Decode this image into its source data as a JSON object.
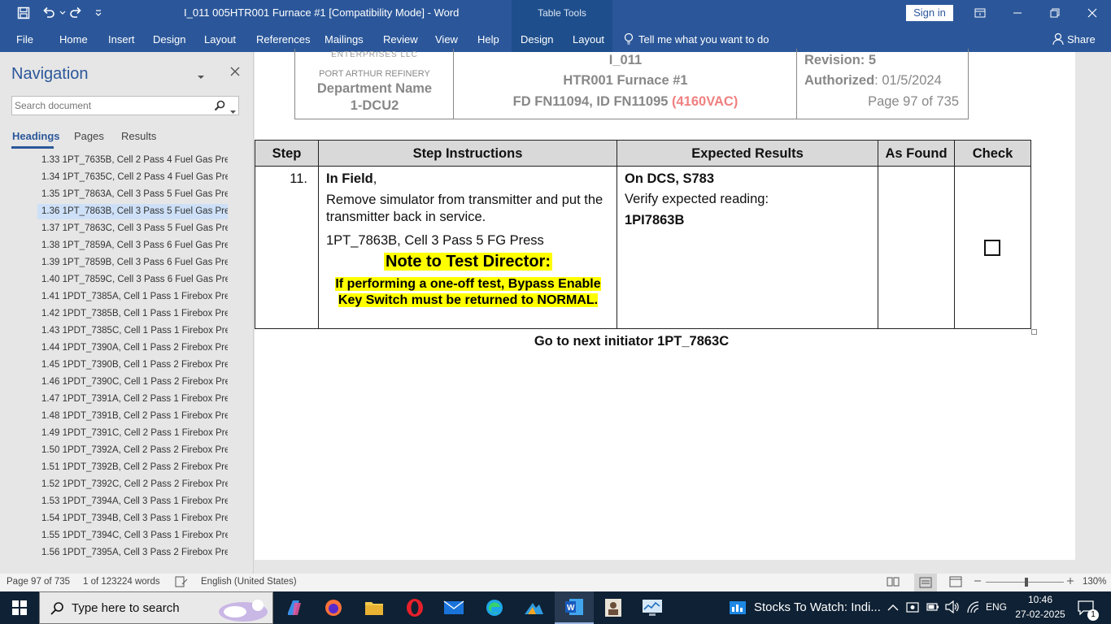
{
  "window": {
    "title": "I_011 005HTR001 Furnace #1 [Compatibility Mode] - Word",
    "table_tools_label": "Table Tools",
    "sign_in": "Sign in"
  },
  "ribbon": {
    "tabs": [
      "File",
      "Home",
      "Insert",
      "Design",
      "Layout",
      "References",
      "Mailings",
      "Review",
      "View",
      "Help",
      "Design",
      "Layout"
    ],
    "tell_me": "Tell me what you want to do",
    "share": "Share"
  },
  "navigation": {
    "title": "Navigation",
    "search_placeholder": "Search document",
    "tabs": [
      "Headings",
      "Pages",
      "Results"
    ],
    "selected_index": 3,
    "headings": [
      "1.33 1PT_7635B, Cell 2 Pass 4 Fuel Gas Pre...",
      "1.34 1PT_7635C, Cell 2 Pass 4 Fuel Gas Pre...",
      "1.35 1PT_7863A, Cell 3 Pass 5 Fuel Gas Pre...",
      "1.36 1PT_7863B, Cell 3 Pass 5 Fuel Gas Pre...",
      "1.37 1PT_7863C, Cell 3 Pass 5 Fuel Gas Pre...",
      "1.38 1PT_7859A, Cell 3 Pass 6 Fuel Gas Pre...",
      "1.39 1PT_7859B, Cell 3 Pass 6 Fuel Gas Pre...",
      "1.40 1PT_7859C, Cell 3 Pass 6 Fuel Gas Pre...",
      "1.41 1PDT_7385A, Cell 1 Pass 1 Firebox Pre...",
      "1.42 1PDT_7385B, Cell 1 Pass 1 Firebox Pre...",
      "1.43 1PDT_7385C, Cell 1 Pass 1 Firebox Pre...",
      "1.44 1PDT_7390A, Cell 1 Pass 2 Firebox Pre...",
      "1.45 1PDT_7390B, Cell 1 Pass 2 Firebox Pre...",
      "1.46 1PDT_7390C, Cell 1 Pass 2 Firebox Pre...",
      "1.47 1PDT_7391A, Cell 2 Pass 1 Firebox Pre...",
      "1.48 1PDT_7391B, Cell 2 Pass 1 Firebox Pre...",
      "1.49 1PDT_7391C, Cell 2 Pass 1 Firebox Pre...",
      "1.50 1PDT_7392A, Cell 2 Pass 2 Firebox Pre...",
      "1.51 1PDT_7392B, Cell 2 Pass 2 Firebox Pre...",
      "1.52 1PDT_7392C, Cell 2 Pass 2 Firebox Pre...",
      "1.53 1PDT_7394A, Cell 3 Pass 1 Firebox Pre...",
      "1.54 1PDT_7394B, Cell 3 Pass 1 Firebox Pre...",
      "1.55 1PDT_7394C, Cell 3 Pass 1 Firebox Pre...",
      "1.56 1PDT_7395A, Cell 3 Pass 2 Firebox Pre..."
    ]
  },
  "doc_header": {
    "company_partial": "ENTERPRISES LLC",
    "refinery": "PORT ARTHUR REFINERY",
    "dept_line1": "Department Name",
    "dept_line2": "1-DCU2",
    "doc_id": "I_011",
    "equipment": "HTR001 Furnace #1",
    "fd_line": "FD FN11094, ID FN11095 ",
    "voltage": "(4160VAC)",
    "revision": "Revision: 5",
    "authorized_label": "Authorized",
    "authorized_date": ": 01/5/2024",
    "page_label": "Page 97 of 735"
  },
  "step_table": {
    "headers": [
      "Step",
      "Step Instructions",
      "Expected Results",
      "As Found",
      "Check"
    ],
    "step_number": "11.",
    "instr_field": "In Field",
    "instr_comma": ",",
    "instr_line1": "Remove simulator from transmitter and put the transmitter back in service.",
    "instr_line2": "1PT_7863B, Cell 3 Pass 5 FG Press",
    "note_title": "Note to Test Director:",
    "note_body": "If performing a one-off test, Bypass Enable Key Switch must be returned to NORMAL.",
    "expected_line1": "On DCS, S783",
    "expected_line2": "Verify expected reading:",
    "expected_line3": "1PI7863B"
  },
  "after_table": "Go to next initiator 1PT_7863C",
  "status": {
    "page": "Page 97 of 735",
    "words": "1 of 123224 words",
    "language": "English (United States)",
    "zoom": "130%"
  },
  "taskbar": {
    "search_placeholder": "Type here to search",
    "news": "Stocks To Watch: Indi...",
    "lang": "ENG",
    "time": "10:46",
    "date": "27-02-2025",
    "notif_count": "1"
  },
  "colors": {
    "word_blue": "#2b579a",
    "highlight": "#ffff00",
    "voltage_red": "#f08080",
    "taskbar": "#0f2134"
  }
}
